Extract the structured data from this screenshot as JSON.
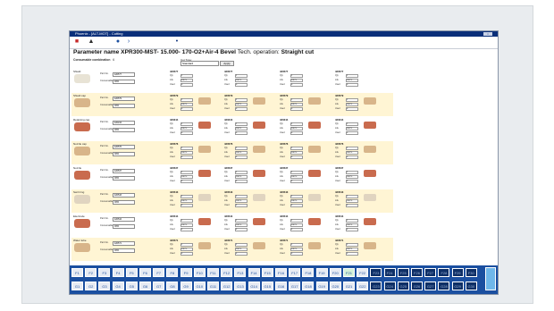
{
  "window": {
    "title": "Phoenix - [ALT-MOT] - Cutting",
    "close_label": "×"
  },
  "toolbar": {
    "icons": [
      "stop-icon",
      "tool-icon",
      "operator-icon",
      "arrow-icon",
      "pin-icon"
    ]
  },
  "header": {
    "param_label": "Parameter name",
    "param_value": "XPR300-MST- 15.000- 170-O2+Air-4 Bevel",
    "tech_label": "Tech. operation:",
    "tech_value": "Straight cut",
    "consumables_label": "Consumable combination",
    "consumables_count": "6",
    "process_label": "Cut Type:",
    "process_select_value": "Standard",
    "process_button": "Apply"
  },
  "left_rows": [
    {
      "label": "Shield",
      "field1_key": "Part No.",
      "field1_val": "420577",
      "field2_key": "Consumable",
      "field2_val": "XPR"
    },
    {
      "label": "Shield cap",
      "field1_key": "Part No.",
      "field1_val": "420579",
      "field2_key": "Consumable",
      "field2_val": "XPR"
    },
    {
      "label": "Retaining cap",
      "field1_key": "Part No.",
      "field1_val": "420244",
      "field2_key": "Consumable",
      "field2_val": "XPR"
    },
    {
      "label": "Nozzle cap",
      "field1_key": "Part No.",
      "field1_val": "420576",
      "field2_key": "Consumable",
      "field2_val": "XPR"
    },
    {
      "label": "Nozzle",
      "field1_key": "Part No.",
      "field1_val": "420537",
      "field2_key": "Consumable",
      "field2_val": "XPR"
    },
    {
      "label": "Swirl ring",
      "field1_key": "Part No.",
      "field1_val": "420543",
      "field2_key": "Consumable",
      "field2_val": "XPR"
    },
    {
      "label": "Electrode",
      "field1_key": "Part No.",
      "field1_val": "420544",
      "field2_key": "Consumable",
      "field2_val": "XPR"
    },
    {
      "label": "Water tube",
      "field1_key": "Part No.",
      "field1_val": "420571",
      "field2_key": "Consumable",
      "field2_val": "XPR"
    }
  ],
  "cells": {
    "part_prefix": "420",
    "qty_key": "Qty",
    "life_key": "Life",
    "used_key": "Used",
    "qty_val": "1",
    "life_val": "100 %",
    "used_val": "0"
  },
  "columns": [
    "Set 1",
    "Set 2",
    "Set 3",
    "Set 4"
  ],
  "bottom_bar": {
    "buttons_row1": [
      "F1",
      "F2",
      "F3",
      "F4",
      "F5",
      "F6",
      "F7",
      "F8",
      "F9",
      "F10",
      "F11",
      "F12",
      "F13",
      "F14",
      "F15",
      "F16",
      "F17",
      "F18",
      "F19",
      "F20",
      "F21",
      "F22",
      "F23",
      "F24",
      "F25",
      "F26",
      "F27",
      "F28",
      "F29",
      "F30"
    ],
    "buttons_row2": [
      "G1",
      "G2",
      "G3",
      "G4",
      "G5",
      "G6",
      "G7",
      "G8",
      "G9",
      "G10",
      "G11",
      "G12",
      "G13",
      "G14",
      "G15",
      "G16",
      "G17",
      "G18",
      "G19",
      "G20",
      "G21",
      "G22",
      "G23",
      "G24",
      "G25",
      "G26",
      "G27",
      "G28",
      "G29",
      "G30"
    ]
  },
  "colors": {
    "accent": "#1b4fa0",
    "row_highlight": "#fff5d4",
    "copper": "#c96b4e",
    "brass": "#d8b58a"
  }
}
